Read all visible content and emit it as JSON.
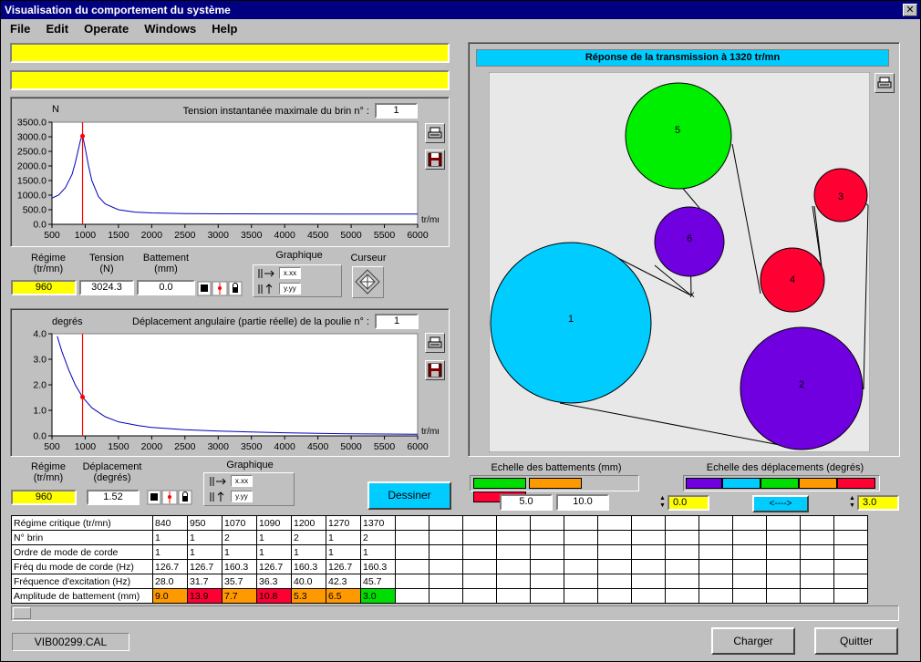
{
  "window": {
    "title": "Visualisation du comportement du système",
    "close_glyph": "✕"
  },
  "menu": [
    "File",
    "Edit",
    "Operate",
    "Windows",
    "Help"
  ],
  "chart1": {
    "unit_label": "N",
    "header_label": "Tension instantanée maximale du brin n° :",
    "brin_value": "1",
    "x_unit": "tr/mn",
    "y_ticks": [
      "3500.0",
      "3000.0",
      "2500.0",
      "2000.0",
      "1500.0",
      "1000.0",
      "500.0",
      "0.0"
    ],
    "x_ticks": [
      "500",
      "1000",
      "1500",
      "2000",
      "2500",
      "3000",
      "3500",
      "4000",
      "4500",
      "5000",
      "5500",
      "6000"
    ]
  },
  "readout1": {
    "regime_label": "Régime (tr/mn)",
    "regime_value": "960",
    "tension_label": "Tension (N)",
    "tension_value": "3024.3",
    "battement_label": "Battement (mm)",
    "battement_value": "0.0",
    "graphique_label": "Graphique",
    "curseur_label": "Curseur",
    "xfmt": "x.xx",
    "yfmt": "y.yy"
  },
  "chart2": {
    "unit_label": "degrés",
    "header_label": "Déplacement angulaire (partie réelle) de la poulie n° :",
    "poulie_value": "1",
    "x_unit": "tr/mn",
    "y_ticks": [
      "4.0",
      "3.0",
      "2.0",
      "1.0",
      "0.0"
    ],
    "x_ticks": [
      "500",
      "1000",
      "1500",
      "2000",
      "2500",
      "3000",
      "3500",
      "4000",
      "4500",
      "5000",
      "5500",
      "6000"
    ]
  },
  "readout2": {
    "regime_label": "Régime (tr/mn)",
    "regime_value": "960",
    "deplacement_label": "Déplacement (degrés)",
    "deplacement_value": "1.52",
    "graphique_label": "Graphique",
    "xfmt": "x.xx",
    "yfmt": "y.yy"
  },
  "chart_data": [
    {
      "type": "line",
      "title": "Tension instantanée maximale du brin n° : 1",
      "xlabel": "tr/mn",
      "ylabel": "N",
      "xlim": [
        500,
        6000
      ],
      "ylim": [
        0,
        3500
      ],
      "cursor_x": 960,
      "series": [
        {
          "color": "#0000c0",
          "x": [
            500,
            600,
            700,
            800,
            850,
            900,
            930,
            960,
            1000,
            1050,
            1100,
            1200,
            1300,
            1500,
            1750,
            2000,
            2500,
            3000,
            4000,
            5000,
            6000
          ],
          "y": [
            900,
            1000,
            1250,
            1700,
            2100,
            2600,
            2900,
            3050,
            2600,
            2000,
            1500,
            950,
            700,
            500,
            420,
            390,
            370,
            360,
            355,
            352,
            350
          ]
        }
      ],
      "cursor_point": [
        960,
        3024.3
      ]
    },
    {
      "type": "line",
      "title": "Déplacement angulaire (partie réelle) de la poulie n° : 1",
      "xlabel": "tr/mn",
      "ylabel": "degrés",
      "xlim": [
        500,
        6000
      ],
      "ylim": [
        0,
        4
      ],
      "cursor_x": 960,
      "series": [
        {
          "color": "#0000c0",
          "x": [
            580,
            650,
            750,
            850,
            960,
            1100,
            1300,
            1500,
            1800,
            2000,
            2500,
            3000,
            3500,
            4000,
            4500,
            5000,
            5500,
            6000
          ],
          "y": [
            3.9,
            3.3,
            2.6,
            2.0,
            1.52,
            1.1,
            0.75,
            0.55,
            0.4,
            0.33,
            0.24,
            0.19,
            0.15,
            0.12,
            0.1,
            0.08,
            0.07,
            0.06
          ]
        }
      ],
      "cursor_point": [
        960,
        1.52
      ]
    }
  ],
  "diagram": {
    "title": "Réponse de la transmission à 1320 tr/mn",
    "pulleys": [
      {
        "label": "1",
        "color": "#00ccff"
      },
      {
        "label": "2",
        "color": "#7000e0"
      },
      {
        "label": "3",
        "color": "#ff0033"
      },
      {
        "label": "4",
        "color": "#ff0033"
      },
      {
        "label": "5",
        "color": "#00ee00"
      },
      {
        "label": "6",
        "color": "#7000e0"
      }
    ],
    "tensioner_mark": "x"
  },
  "scales": {
    "battements_label": "Echelle des battements (mm)",
    "battements_colors": [
      "#00dd00",
      "#ff9900",
      "#ff0033"
    ],
    "battements_min": "5.0",
    "battements_max": "10.0",
    "deplacements_label": "Echelle des déplacements (degrés)",
    "deplacements_colors": [
      "#7000e0",
      "#00ccff",
      "#00dd00",
      "#ff9900",
      "#ff0033"
    ],
    "deplacements_min": "0.0",
    "deplacements_max": "3.0",
    "arrow_label": "<---->"
  },
  "buttons": {
    "dessiner": "Dessiner",
    "charger": "Charger",
    "quitter": "Quitter"
  },
  "table": {
    "rows": [
      {
        "label": "Régime critique (tr/mn)",
        "values": [
          "840",
          "950",
          "1070",
          "1090",
          "1200",
          "1270",
          "1370"
        ]
      },
      {
        "label": "N° brin",
        "values": [
          "1",
          "1",
          "2",
          "1",
          "2",
          "1",
          "2"
        ]
      },
      {
        "label": "Ordre de mode de corde",
        "values": [
          "1",
          "1",
          "1",
          "1",
          "1",
          "1",
          "1"
        ]
      },
      {
        "label": "Fréq du mode de corde (Hz)",
        "values": [
          "126.7",
          "126.7",
          "160.3",
          "126.7",
          "160.3",
          "126.7",
          "160.3"
        ]
      },
      {
        "label": "Fréquence d'excitation (Hz)",
        "values": [
          "28.0",
          "31.7",
          "35.7",
          "36.3",
          "40.0",
          "42.3",
          "45.7"
        ]
      },
      {
        "label": "Amplitude de battement (mm)",
        "values": [
          "9.0",
          "13.9",
          "7.7",
          "10.8",
          "5.3",
          "6.5",
          "3.0"
        ]
      }
    ],
    "amp_colors": [
      "#ff9900",
      "#ff0033",
      "#ff9900",
      "#ff0033",
      "#ff9900",
      "#ff9900",
      "#00dd00"
    ]
  },
  "status": {
    "filename": "VIB00299.CAL"
  }
}
